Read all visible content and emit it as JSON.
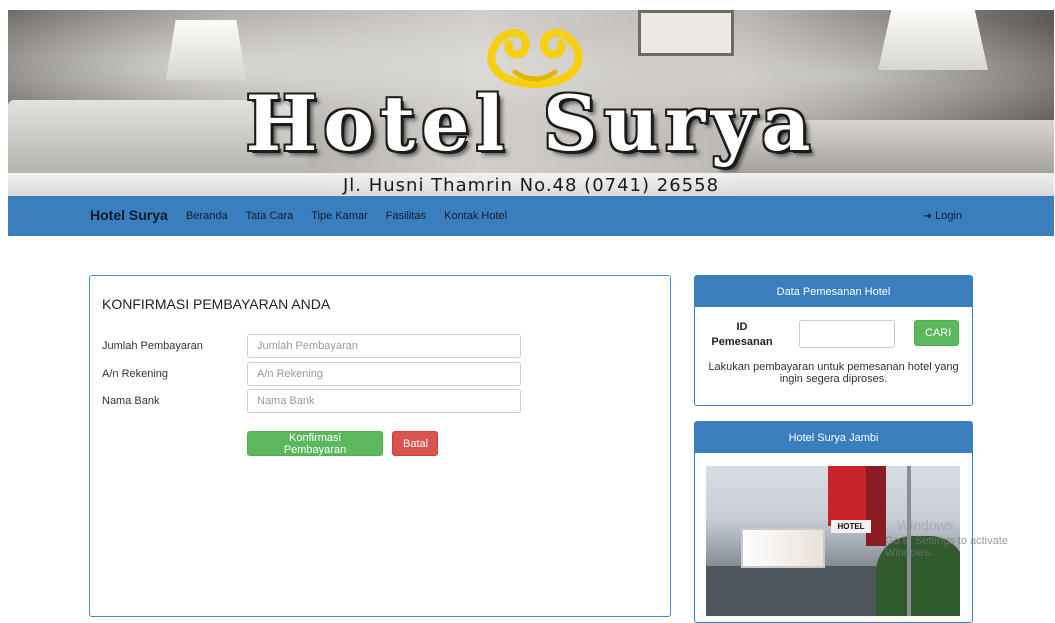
{
  "banner": {
    "title": "Hotel Surya",
    "address": "Jl. Husni Thamrin No.48 (0741) 26558"
  },
  "navbar": {
    "brand": "Hotel Surya",
    "items": [
      {
        "label": "Beranda"
      },
      {
        "label": "Tata Cara"
      },
      {
        "label": "Tipe Kamar"
      },
      {
        "label": "Fasilitas"
      },
      {
        "label": "Kontak Hotel"
      }
    ],
    "login": "Login"
  },
  "form": {
    "title": "KONFIRMASI PEMBAYARAN ANDA",
    "fields": [
      {
        "label": "Jumlah Pembayaran",
        "placeholder": "Jumlah Pembayaran",
        "value": ""
      },
      {
        "label": "A/n Rekening",
        "placeholder": "A/n Rekening",
        "value": ""
      },
      {
        "label": "Nama Bank",
        "placeholder": "Nama Bank",
        "value": ""
      }
    ],
    "submit_label": "Konfirmasi Pembayaran",
    "cancel_label": "Batal"
  },
  "booking": {
    "header": "Data Pemesanan Hotel",
    "id_label": "ID Pemesanan",
    "search_label": "CARI",
    "info": "Lakukan pembayaran untuk pemesanan hotel yang ingin segera diproses."
  },
  "hotel_card": {
    "header": "Hotel Surya Jambi",
    "sign_text": "HOTEL"
  },
  "watermark": {
    "line1": "Windows",
    "line2": "Go to Settings to activate Windows."
  },
  "colors": {
    "navbar": "#3a7ebe",
    "panel_border": "#4b8fcf",
    "success": "#5cb85c",
    "danger": "#d9534f"
  }
}
